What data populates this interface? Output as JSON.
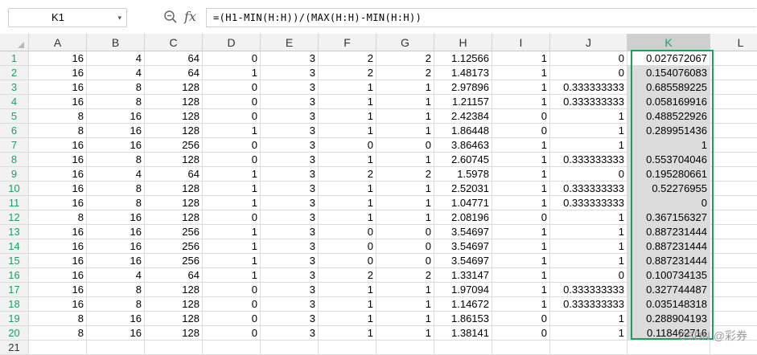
{
  "name_box": "K1",
  "formula": "=(H1-MIN(H:H))/(MAX(H:H)-MIN(H:H))",
  "columns": [
    "A",
    "B",
    "C",
    "D",
    "E",
    "F",
    "G",
    "H",
    "I",
    "J",
    "K",
    "L"
  ],
  "selected_column": "K",
  "rows": [
    [
      "16",
      "4",
      "64",
      "0",
      "3",
      "2",
      "2",
      "1.12566",
      "1",
      "0",
      "0.027672067"
    ],
    [
      "16",
      "4",
      "64",
      "1",
      "3",
      "2",
      "2",
      "1.48173",
      "1",
      "0",
      "0.154076083"
    ],
    [
      "16",
      "8",
      "128",
      "0",
      "3",
      "1",
      "1",
      "2.97896",
      "1",
      "0.333333333",
      "0.685589225"
    ],
    [
      "16",
      "8",
      "128",
      "0",
      "3",
      "1",
      "1",
      "1.21157",
      "1",
      "0.333333333",
      "0.058169916"
    ],
    [
      "8",
      "16",
      "128",
      "0",
      "3",
      "1",
      "1",
      "2.42384",
      "0",
      "1",
      "0.488522926"
    ],
    [
      "8",
      "16",
      "128",
      "1",
      "3",
      "1",
      "1",
      "1.86448",
      "0",
      "1",
      "0.289951436"
    ],
    [
      "16",
      "16",
      "256",
      "0",
      "3",
      "0",
      "0",
      "3.86463",
      "1",
      "1",
      "1"
    ],
    [
      "16",
      "8",
      "128",
      "0",
      "3",
      "1",
      "1",
      "2.60745",
      "1",
      "0.333333333",
      "0.553704046"
    ],
    [
      "16",
      "4",
      "64",
      "1",
      "3",
      "2",
      "2",
      "1.5978",
      "1",
      "0",
      "0.195280661"
    ],
    [
      "16",
      "8",
      "128",
      "1",
      "3",
      "1",
      "1",
      "2.52031",
      "1",
      "0.333333333",
      "0.52276955"
    ],
    [
      "16",
      "8",
      "128",
      "1",
      "3",
      "1",
      "1",
      "1.04771",
      "1",
      "0.333333333",
      "0"
    ],
    [
      "8",
      "16",
      "128",
      "0",
      "3",
      "1",
      "1",
      "2.08196",
      "0",
      "1",
      "0.367156327"
    ],
    [
      "16",
      "16",
      "256",
      "1",
      "3",
      "0",
      "0",
      "3.54697",
      "1",
      "1",
      "0.887231444"
    ],
    [
      "16",
      "16",
      "256",
      "1",
      "3",
      "0",
      "0",
      "3.54697",
      "1",
      "1",
      "0.887231444"
    ],
    [
      "16",
      "16",
      "256",
      "1",
      "3",
      "0",
      "0",
      "3.54697",
      "1",
      "1",
      "0.887231444"
    ],
    [
      "16",
      "4",
      "64",
      "1",
      "3",
      "2",
      "2",
      "1.33147",
      "1",
      "0",
      "0.100734135"
    ],
    [
      "16",
      "8",
      "128",
      "0",
      "3",
      "1",
      "1",
      "1.97094",
      "1",
      "0.333333333",
      "0.327744487"
    ],
    [
      "16",
      "8",
      "128",
      "0",
      "3",
      "1",
      "1",
      "1.14672",
      "1",
      "0.333333333",
      "0.035148318"
    ],
    [
      "8",
      "16",
      "128",
      "0",
      "3",
      "1",
      "1",
      "1.86153",
      "0",
      "1",
      "0.288904193"
    ],
    [
      "8",
      "16",
      "128",
      "0",
      "3",
      "1",
      "1",
      "1.38141",
      "0",
      "1",
      "0.118462716"
    ]
  ],
  "extra_row_number": "21",
  "watermark": "CSDN @彩券",
  "accent_color": "#1e9e63"
}
